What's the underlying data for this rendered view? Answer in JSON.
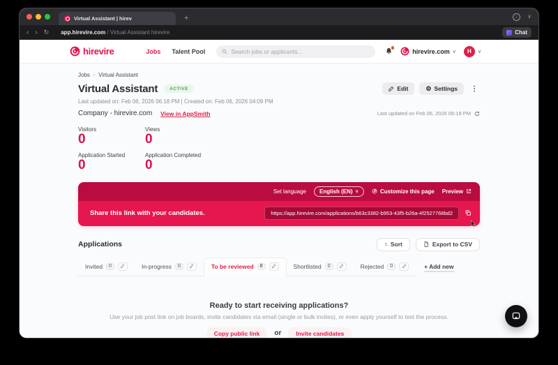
{
  "colors": {
    "brand": "#e11d48",
    "banner_top": "#ba0c40",
    "banner_bottom": "#e6164e",
    "status_green": "#49a65a",
    "stat_value": "#d8134e"
  },
  "icons": {
    "back": "‹",
    "forward": "›",
    "reload": "↻",
    "new_tab": "+",
    "download_arrow": "↓",
    "chevron_down": "∨",
    "breadcrumb_separator": "›",
    "gear": "⚙",
    "kebab": "⋮",
    "sort": "↑↓"
  },
  "browser": {
    "tab_title": "Virtual Assistant | hirev",
    "url_host": "app.hirevire.com",
    "url_rest": " / Virtual Assistant hirevire",
    "chat_label": "Chat"
  },
  "header": {
    "brand": "hirevire",
    "nav": [
      {
        "label": "Jobs"
      },
      {
        "label": "Talent Pool"
      }
    ],
    "search_placeholder": "Search jobs or applicants...",
    "org": "hirevire.com",
    "avatar_initial": "H"
  },
  "breadcrumb": {
    "items": [
      "Jobs",
      "Virtual Assistant"
    ]
  },
  "job": {
    "title": "Virtual Assistant",
    "status": "ACTIVE",
    "meta": "Last updated on: Feb 06, 2026 06:18 PM | Created on: Feb 06, 2026 04:09 PM",
    "company_label": "Company - hirevire.com",
    "appsmith_link": "View in AppSmith",
    "edit_label": "Edit",
    "settings_label": "Settings",
    "last_refreshed": "Last updated on Feb 06, 2026 06:18 PM"
  },
  "stats": [
    {
      "label": "Visitors",
      "value": "0"
    },
    {
      "label": "Views",
      "value": "0"
    },
    {
      "label": "Application Started",
      "value": "0"
    },
    {
      "label": "Application Completed",
      "value": "0"
    }
  ],
  "share_banner": {
    "set_language_label": "Set language",
    "language": "English (EN)",
    "customize_label": "Customize this page",
    "preview_label": "Preview",
    "share_text": "Share this link with your candidates.",
    "link": "https://app.hirevire.com/applications/b63c3382-b953-43f5-b26a-4f2527768bd2"
  },
  "applications": {
    "heading": "Applications",
    "sort_label": "Sort",
    "export_label": "Export to CSV",
    "tabs": [
      {
        "label": "Invited",
        "count": "0"
      },
      {
        "label": "In-progress",
        "count": "0"
      },
      {
        "label": "To be reviewed",
        "count": "0"
      },
      {
        "label": "Shortlisted",
        "count": "0"
      },
      {
        "label": "Rejected",
        "count": "0"
      }
    ],
    "add_new_label": "+ Add new"
  },
  "empty_state": {
    "heading": "Ready to start receiving applications?",
    "description": "Use your job post link on job boards, invite candidates via email (single or bulk invites), or even apply yourself to test the process.",
    "copy_link_label": "Copy public link",
    "or_label": "or",
    "invite_label": "Invite candidates"
  }
}
